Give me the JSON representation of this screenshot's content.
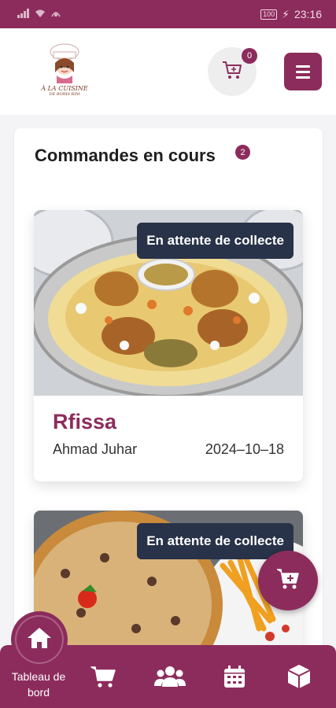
{
  "status_bar": {
    "time": "23:16",
    "battery": "100",
    "network": "4G"
  },
  "header": {
    "logo_text_line1": "À LA CUISINE",
    "logo_text_line2": "DE BORIS RIM",
    "cart_count": "0"
  },
  "orders_section": {
    "title": "Commandes en cours",
    "count": "2"
  },
  "orders": [
    {
      "status": "En attente de collecte",
      "name": "Rfissa",
      "customer": "Ahmad Juhar",
      "date": "2024–10–18"
    },
    {
      "status": "En attente de collecte"
    }
  ],
  "bottom_nav": {
    "home_label": "Tableau de bord",
    "items": [
      "cart-icon",
      "users-icon",
      "calendar-icon",
      "box-icon"
    ]
  },
  "colors": {
    "primary": "#8c2c5c",
    "status_pill": "#283248",
    "background": "#f4f4f6"
  }
}
